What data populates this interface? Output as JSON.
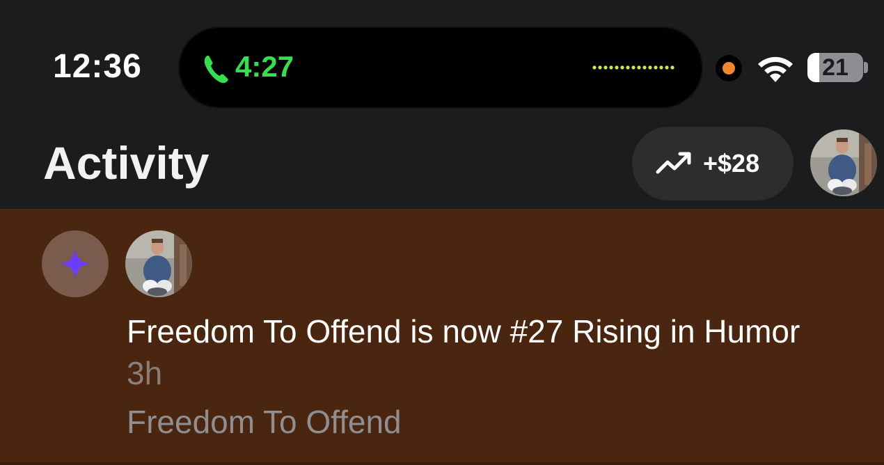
{
  "status_bar": {
    "time": "12:36",
    "call_duration": "4:27",
    "battery_level": "21",
    "battery_fraction": 0.21,
    "icons": [
      "phone-icon",
      "waveform-icon",
      "recording-dot-icon",
      "wifi-icon",
      "battery-icon"
    ]
  },
  "header": {
    "title": "Activity",
    "earnings": "+$28",
    "earnings_icon": "trending-up-icon",
    "avatar": "profile-avatar"
  },
  "notifications": [
    {
      "icon": "sparkle-icon",
      "message": "Freedom To Offend is now #27 Rising in Humor",
      "time": "3h",
      "source": "Freedom To Offend"
    }
  ],
  "colors": {
    "background": "#1b1c1e",
    "notification_bg": "#4a250f",
    "call_green": "#34e04d",
    "recording_orange": "#f2872b",
    "sparkle_purple": "#6b3cff"
  }
}
